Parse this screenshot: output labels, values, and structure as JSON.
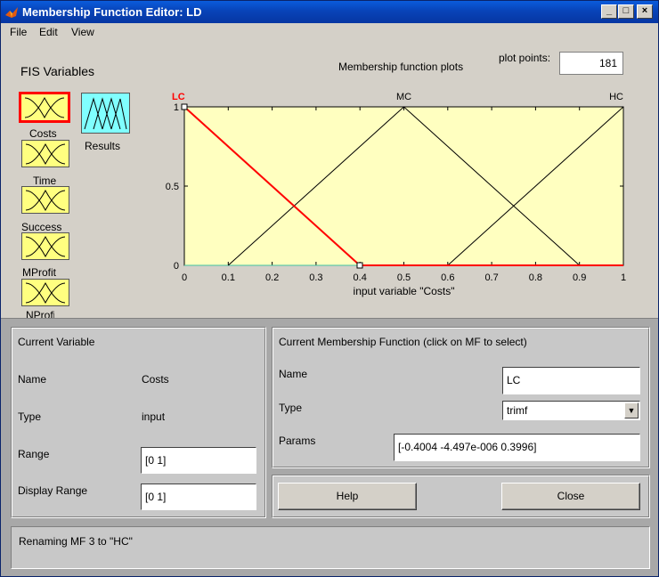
{
  "window": {
    "title": "Membership Function Editor: LD",
    "controls": {
      "minimize": "_",
      "maximize": "□",
      "close": "×"
    }
  },
  "menu": [
    "File",
    "Edit",
    "View"
  ],
  "fis": {
    "title": "FIS Variables",
    "inputs": [
      "Costs",
      "Time",
      "Success",
      "MProfit",
      "NProfit"
    ],
    "outputs": [
      "Results"
    ],
    "selected": "Costs"
  },
  "plot": {
    "title": "Membership function plots",
    "plot_points_label": "plot points:",
    "plot_points_value": "181"
  },
  "chart_data": {
    "type": "line",
    "xlabel": "input variable \"Costs\"",
    "xlim": [
      0,
      1
    ],
    "ylim": [
      0,
      1
    ],
    "xticks": [
      "0",
      "0.1",
      "0.2",
      "0.3",
      "0.4",
      "0.5",
      "0.6",
      "0.7",
      "0.8",
      "0.9",
      "1"
    ],
    "yticks": [
      "0",
      "0.5",
      "1"
    ],
    "series": [
      {
        "name": "LC",
        "x": [
          -0.4004,
          0,
          0.3996,
          1
        ],
        "y": [
          0,
          1,
          0,
          0
        ],
        "selected": true,
        "color": "#ff0000"
      },
      {
        "name": "MC",
        "x": [
          0.1,
          0.5,
          0.9
        ],
        "y": [
          0,
          1,
          0
        ],
        "selected": false,
        "color": "#000000"
      },
      {
        "name": "HC",
        "x": [
          0.6,
          1,
          1.4
        ],
        "y": [
          0,
          1,
          0
        ],
        "selected": false,
        "color": "#000000"
      }
    ],
    "background": "#ffffc0"
  },
  "current_variable": {
    "title": "Current Variable",
    "name_label": "Name",
    "name_value": "Costs",
    "type_label": "Type",
    "type_value": "input",
    "range_label": "Range",
    "range_value": "[0 1]",
    "display_range_label": "Display Range",
    "display_range_value": "[0 1]"
  },
  "current_mf": {
    "title": "Current Membership Function (click on MF to select)",
    "name_label": "Name",
    "name_value": "LC",
    "type_label": "Type",
    "type_value": "trimf",
    "params_label": "Params",
    "params_value": "[-0.4004 -4.497e-006 0.3996]"
  },
  "buttons": {
    "help": "Help",
    "close": "Close"
  },
  "status": "Renaming MF 3 to \"HC\""
}
